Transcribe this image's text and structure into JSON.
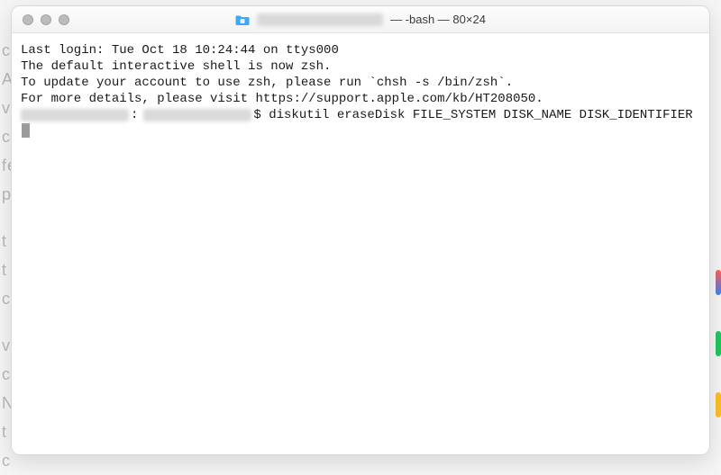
{
  "window": {
    "title_suffix": "— -bash — 80×24"
  },
  "terminal": {
    "last_login": "Last login: Tue Oct 18 10:24:44 on ttys000",
    "zsh_notice_1": "The default interactive shell is now zsh.",
    "zsh_notice_2": "To update your account to use zsh, please run `chsh -s /bin/zsh`.",
    "zsh_notice_3": "For more details, please visit https://support.apple.com/kb/HT208050.",
    "prompt_marker": "$",
    "command": " diskutil eraseDisk FILE_SYSTEM DISK_NAME DISK_IDENTIFIER"
  }
}
